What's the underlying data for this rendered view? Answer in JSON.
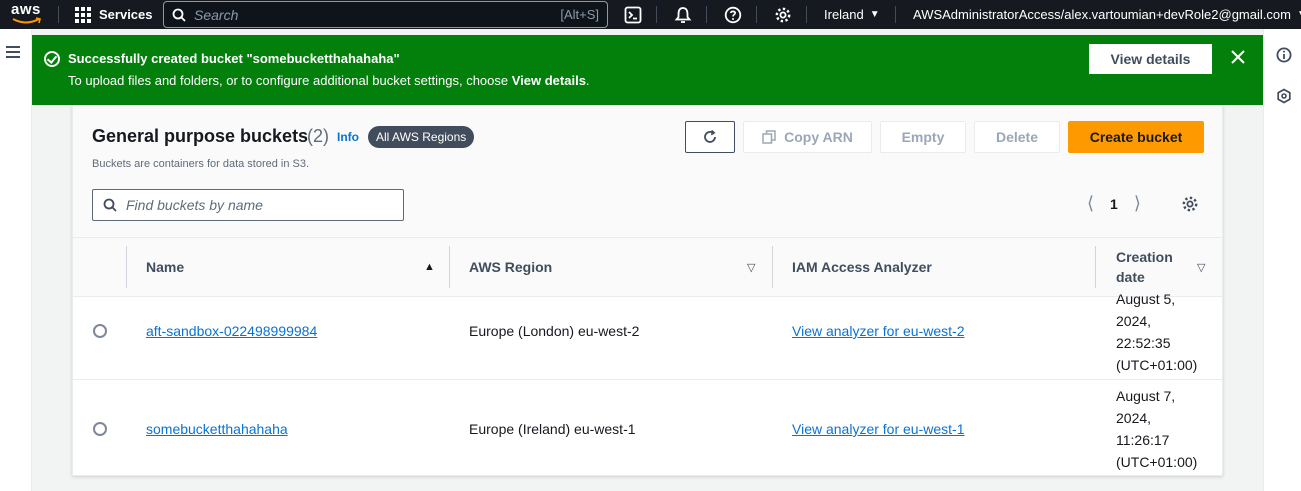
{
  "topnav": {
    "logo": "aws",
    "services_label": "Services",
    "search_placeholder": "Search",
    "search_shortcut": "[Alt+S]",
    "region": "Ireland",
    "account": "AWSAdministratorAccess/alex.vartoumian+devRole2@gmail.com",
    "icons": [
      "cloudshell-icon",
      "bell-icon",
      "help-icon",
      "settings-icon"
    ]
  },
  "flash": {
    "title": "Successfully created bucket \"somebucketthahahaha\"",
    "message_prefix": "To upload files and folders, or to configure additional bucket settings, choose ",
    "message_bold": "View details",
    "message_suffix": ".",
    "view_details_label": "View details",
    "color": "#037f0c"
  },
  "panel": {
    "title": "General purpose buckets",
    "count": "(2)",
    "info": "Info",
    "regions_badge": "All AWS Regions",
    "subtitle": "Buckets are containers for data stored in S3.",
    "buttons": {
      "copy_arn": "Copy ARN",
      "empty": "Empty",
      "delete": "Delete",
      "create": "Create bucket"
    },
    "search_placeholder": "Find buckets by name",
    "page": "1"
  },
  "table": {
    "columns": [
      "Name",
      "AWS Region",
      "IAM Access Analyzer",
      "Creation date"
    ],
    "rows": [
      {
        "name": "aft-sandbox-022498999984",
        "region": "Europe (London) eu-west-2",
        "analyzer": "View analyzer for eu-west-2",
        "date_lines": [
          "August 5,",
          "2024,",
          "22:52:35",
          "(UTC+01:00)"
        ]
      },
      {
        "name": "somebucketthahahaha",
        "region": "Europe (Ireland) eu-west-1",
        "analyzer": "View analyzer for eu-west-1",
        "date_lines": [
          "August 7,",
          "2024,",
          "11:26:17",
          "(UTC+01:00)"
        ]
      }
    ]
  }
}
